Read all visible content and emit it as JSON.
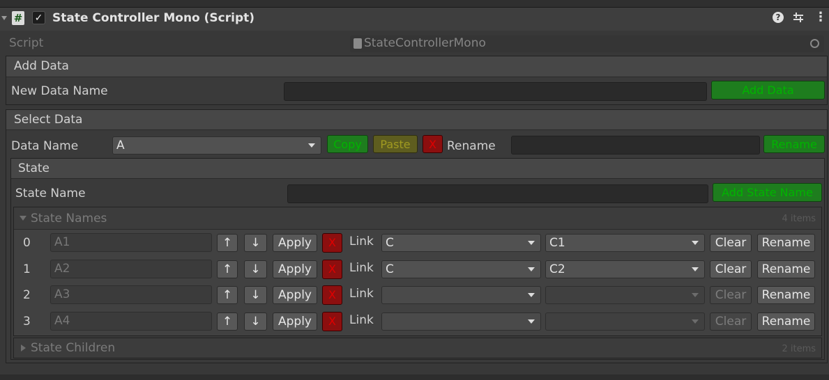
{
  "component": {
    "title": "State Controller Mono (Script)",
    "hash_glyph": "#",
    "check_glyph": "✓",
    "help_glyph": "?",
    "menu_glyph": "⋮"
  },
  "script_row": {
    "label": "Script",
    "value": "StateControllerMono"
  },
  "add_data": {
    "header": "Add Data",
    "name_label": "New Data Name",
    "name_value": "",
    "button": "Add Data"
  },
  "select_data": {
    "header": "Select Data",
    "data_name_label": "Data Name",
    "data_name_value": "A",
    "copy": "Copy",
    "paste": "Paste",
    "x": "X",
    "rename_label": "Rename",
    "rename_value": "",
    "rename_button": "Rename"
  },
  "state": {
    "header": "State",
    "name_label": "State Name",
    "name_value": "",
    "add_button": "Add State Name",
    "list": {
      "header": "State Names",
      "count": "4 items",
      "rows": [
        {
          "index": "0",
          "name": "A1",
          "up": "↑",
          "down": "↓",
          "apply": "Apply",
          "x": "X",
          "link": "Link",
          "link1": "C",
          "link2": "C1",
          "clear": "Clear",
          "rename": "Rename"
        },
        {
          "index": "1",
          "name": "A2",
          "up": "↑",
          "down": "↓",
          "apply": "Apply",
          "x": "X",
          "link": "Link",
          "link1": "C",
          "link2": "C2",
          "clear": "Clear",
          "rename": "Rename"
        },
        {
          "index": "2",
          "name": "A3",
          "up": "↑",
          "down": "↓",
          "apply": "Apply",
          "x": "X",
          "link": "Link",
          "link1": "",
          "link2": "",
          "clear": "Clear",
          "rename": "Rename"
        },
        {
          "index": "3",
          "name": "A4",
          "up": "↑",
          "down": "↓",
          "apply": "Apply",
          "x": "X",
          "link": "Link",
          "link1": "",
          "link2": "",
          "clear": "Clear",
          "rename": "Rename"
        }
      ]
    },
    "children": {
      "header": "State Children",
      "count": "2 items"
    }
  },
  "colors": {
    "green": "#1e7d1e",
    "red": "#8c0f0f",
    "yellow": "#5a5a1e"
  }
}
